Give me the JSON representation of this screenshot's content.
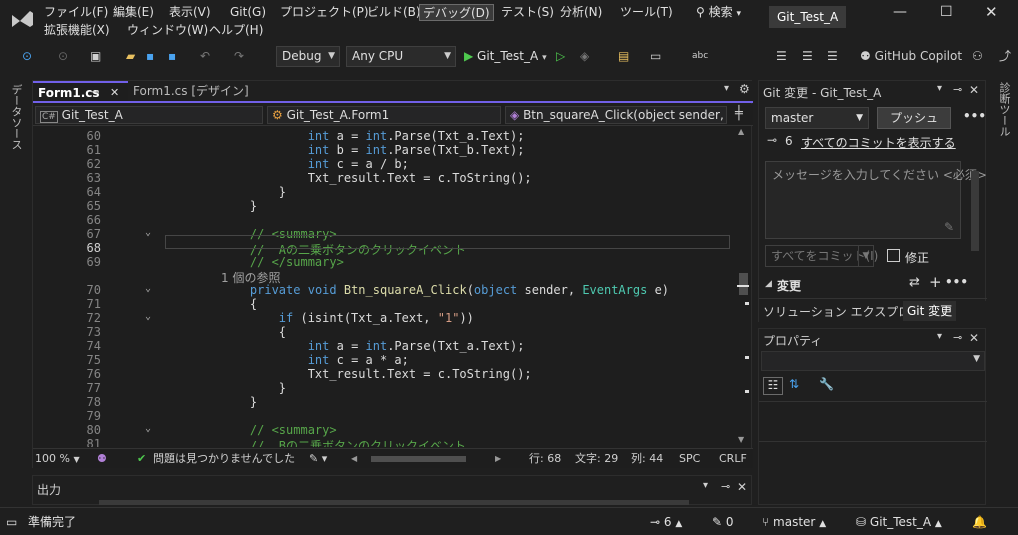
{
  "menus": [
    "ファイル(F)",
    "編集(E)",
    "表示(V)",
    "Git(G)",
    "プロジェクト(P)",
    "ビルド(B)",
    "デバッグ(D)",
    "テスト(S)",
    "分析(N)",
    "ツール(T)",
    "拡張機能(X)",
    "ウィンドウ(W)",
    "ヘルプ(H)"
  ],
  "search_label": "検索",
  "solution_name": "Git_Test_A",
  "toolbar": {
    "config": "Debug",
    "platform": "Any CPU",
    "run_target": "Git_Test_A",
    "copilot": "GitHub Copilot"
  },
  "left_strip": "データソース",
  "right_strip": "診断ツール",
  "tabs": [
    {
      "label": "Form1.cs",
      "active": true
    },
    {
      "label": "Form1.cs [デザイン]",
      "active": false
    }
  ],
  "nav": {
    "project": "Git_Test_A",
    "class": "Git_Test_A.Form1",
    "member": "Btn_squareA_Click(object sender, Eve"
  },
  "code_lines": [
    {
      "n": "60",
      "html": "            <span class='kw'>int</span> a = <span class='kw'>int</span>.Parse(Txt_a.Text);"
    },
    {
      "n": "61",
      "html": "            <span class='kw'>int</span> b = <span class='kw'>int</span>.Parse(Txt_b.Text);"
    },
    {
      "n": "62",
      "html": "            <span class='kw'>int</span> c = a / b;"
    },
    {
      "n": "63",
      "html": "            Txt_result.Text = c.ToString();"
    },
    {
      "n": "64",
      "html": "        }"
    },
    {
      "n": "65",
      "html": "    }"
    },
    {
      "n": "66",
      "html": ""
    },
    {
      "n": "67",
      "html": "    <span class='cm'>// &lt;summary&gt;</span>"
    },
    {
      "n": "68",
      "html": "    <span class='cm'>//  Aの二乗ボタンのクリックイベント</span>"
    },
    {
      "n": "69",
      "html": "    <span class='cm'>// &lt;/summary&gt;</span>"
    },
    {
      "n": "ref",
      "html": "1 個の参照"
    },
    {
      "n": "70",
      "html": "    <span class='kw'>private</span> <span class='kw'>void</span> <span class='fn'>Btn_squareA_Click</span>(<span class='kw'>object</span> sender, <span class='ty'>EventArgs</span> e)"
    },
    {
      "n": "71",
      "html": "    {"
    },
    {
      "n": "72",
      "html": "        <span class='kw'>if</span> (isint(Txt_a.Text, <span class='st'>\"1\"</span>))"
    },
    {
      "n": "73",
      "html": "        {"
    },
    {
      "n": "74",
      "html": "            <span class='kw'>int</span> a = <span class='kw'>int</span>.Parse(Txt_a.Text);"
    },
    {
      "n": "75",
      "html": "            <span class='kw'>int</span> c = a * a;"
    },
    {
      "n": "76",
      "html": "            Txt_result.Text = c.ToString();"
    },
    {
      "n": "77",
      "html": "        }"
    },
    {
      "n": "78",
      "html": "    }"
    },
    {
      "n": "79",
      "html": ""
    },
    {
      "n": "80",
      "html": "    <span class='cm'>// &lt;summary&gt;</span>"
    },
    {
      "n": "81",
      "html": "    <span class='cm'>//  Bの二乗ボタンのクリックイベント</span>"
    }
  ],
  "editor_status": {
    "zoom": "100 %",
    "issues": "問題は見つかりませんでした",
    "line": "行: 68",
    "char": "文字: 29",
    "col": "列: 44",
    "spc": "SPC",
    "crlf": "CRLF"
  },
  "output_title": "出力",
  "git": {
    "title": "Git 変更 - Git_Test_A",
    "branch": "master",
    "push": "プッシュ",
    "commit_count": "6",
    "show_all": "すべてのコミットを表示する",
    "message_placeholder": "メッセージを入力してください <必須>",
    "commit_all": "すべてをコミット(I)",
    "amend": "修正",
    "changes": "変更",
    "tab_solution": "ソリューション エクスプローラー",
    "tab_git": "Git 変更"
  },
  "props_title": "プロパティ",
  "statusbar": {
    "ready": "準備完了",
    "commits": "6",
    "edits": "0",
    "branch": "master",
    "repo": "Git_Test_A"
  }
}
